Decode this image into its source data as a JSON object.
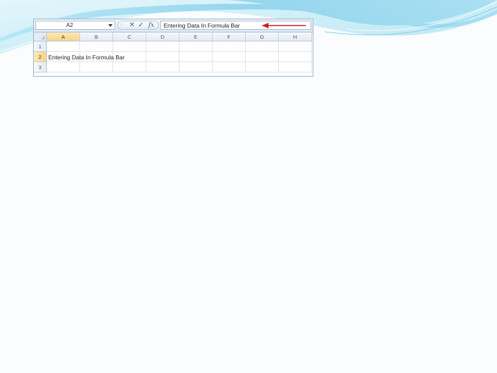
{
  "name_box": {
    "value": "A2"
  },
  "formula_bar": {
    "grip": "⁝",
    "cancel": "✕",
    "enter": "✓",
    "fx": "fx",
    "value": "Entering Data In Formula Bar"
  },
  "columns": [
    "A",
    "B",
    "C",
    "D",
    "E",
    "F",
    "G",
    "H"
  ],
  "rows": [
    "1",
    "2",
    "3"
  ],
  "cells": {
    "A2": "Entering Data In Formula Bar"
  },
  "active_cell": "A2",
  "colors": {
    "arrow": "#cc1f1f",
    "wave_light": "#c9eef8",
    "wave_dark": "#5fc0e3",
    "header_active": "#f7d385"
  }
}
